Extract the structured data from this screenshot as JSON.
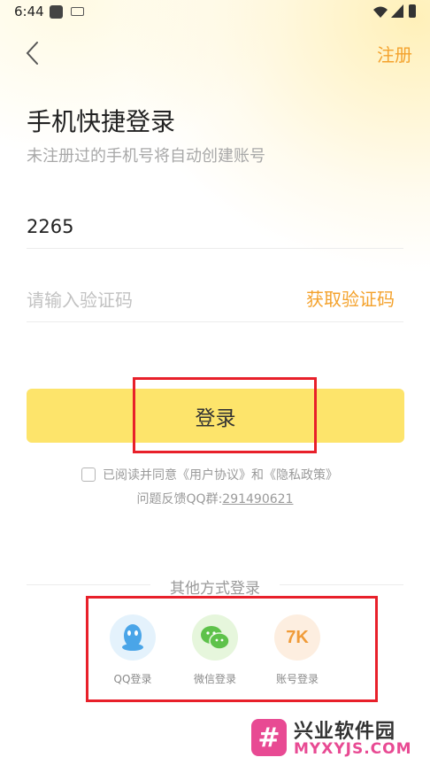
{
  "status_bar": {
    "time": "6:44"
  },
  "header": {
    "register_label": "注册"
  },
  "title": "手机快捷登录",
  "subtitle": "未注册过的手机号将自动创建账号",
  "phone": {
    "value": "2265"
  },
  "code": {
    "placeholder": "请输入验证码",
    "get_code_label": "获取验证码"
  },
  "login_button_label": "登录",
  "agreement": {
    "prefix": "已阅读并同意",
    "user_agreement": "《用户协议》",
    "and": "和",
    "privacy_policy": "《隐私政策》"
  },
  "feedback": {
    "label": "问题反馈QQ群:",
    "qq_group": "291490621"
  },
  "other_login": {
    "title": "其他方式登录",
    "methods": [
      {
        "label": "QQ登录",
        "icon": "qq-icon"
      },
      {
        "label": "微信登录",
        "icon": "wechat-icon"
      },
      {
        "label": "账号登录",
        "icon": "sevenk-logo-icon",
        "icon_text": "7K"
      }
    ]
  },
  "watermark": {
    "cn": "兴业软件园",
    "en": "MYXYJS.COM",
    "mark": "#"
  },
  "colors": {
    "accent": "#f4a22c",
    "button": "#fde46b",
    "highlight": "#e8202a"
  }
}
